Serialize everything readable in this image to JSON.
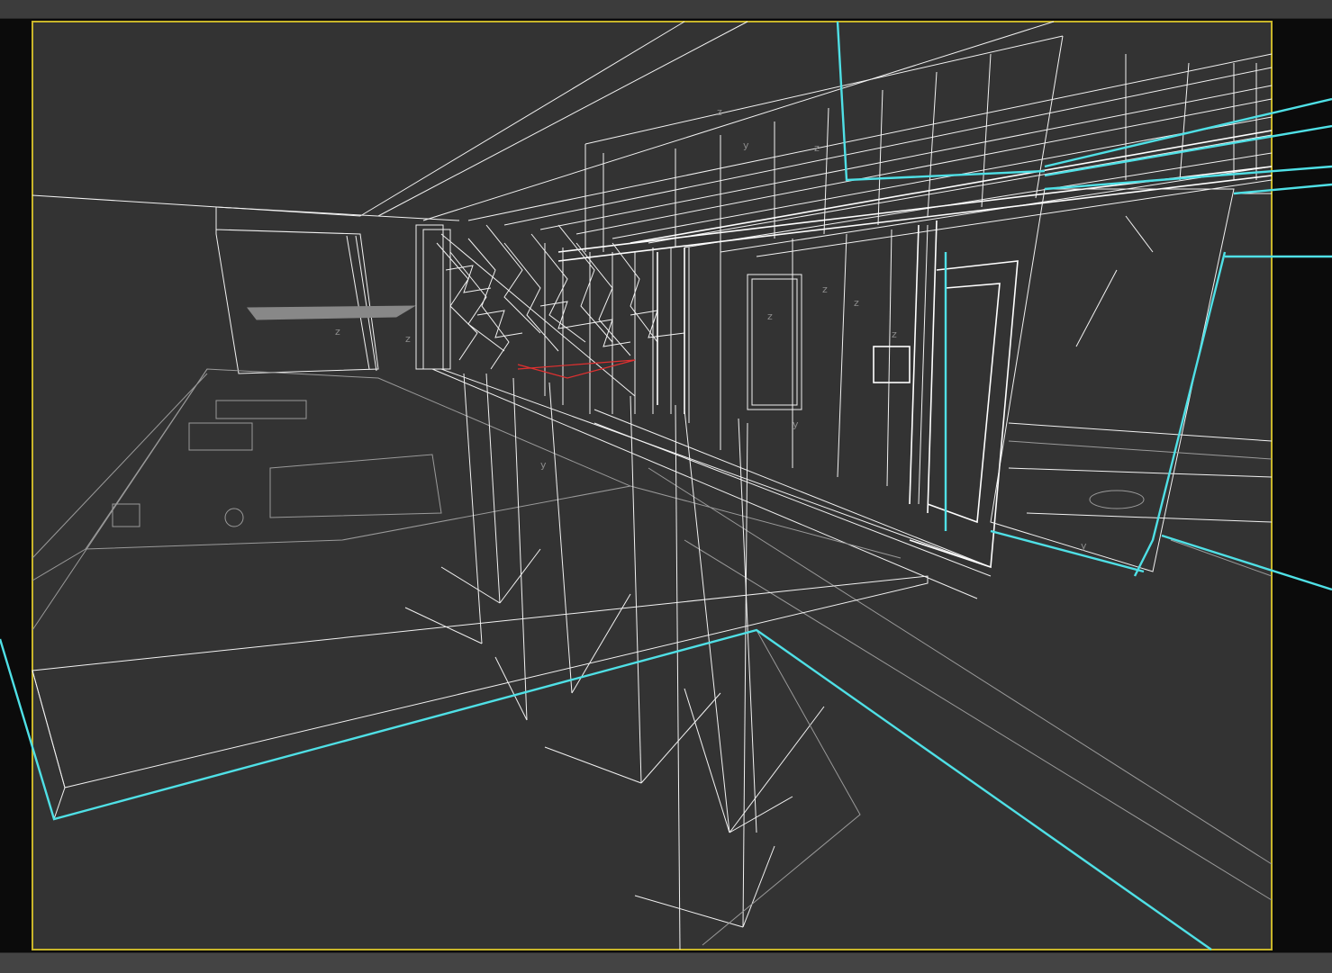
{
  "viewport": {
    "mode": "wireframe",
    "colors": {
      "background": "#333333",
      "outside_safe_frame": "#0b0b0b",
      "safe_frame_border": "#c8b52a",
      "wire": "#f2f2f2",
      "selection": "#4fe0e6",
      "axis_gizmo": "#8c8c8c",
      "highlight": "#e03030"
    },
    "axis_labels": [
      "z",
      "y",
      "z",
      "z",
      "z",
      "z",
      "y",
      "z",
      "y",
      "z",
      "z",
      "y"
    ]
  }
}
